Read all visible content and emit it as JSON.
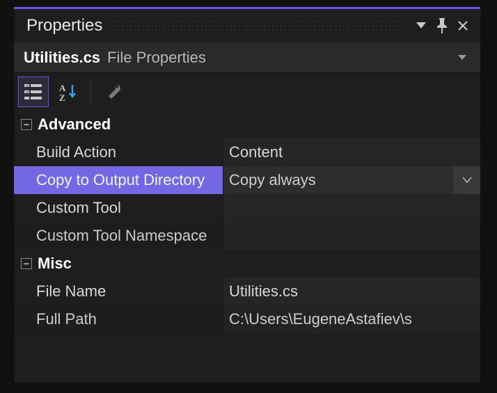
{
  "panel": {
    "title": "Properties"
  },
  "object": {
    "filename": "Utilities.cs",
    "type": "File Properties"
  },
  "toolbar": {
    "categorized": "Categorized",
    "alphabetical": "Alphabetical",
    "propertypages": "Property Pages"
  },
  "groups": [
    {
      "name": "Advanced",
      "expanded": true,
      "props": [
        {
          "name": "Build Action",
          "value": "Content",
          "selected": false
        },
        {
          "name": "Copy to Output Directory",
          "value": "Copy always",
          "selected": true
        },
        {
          "name": "Custom Tool",
          "value": "",
          "selected": false
        },
        {
          "name": "Custom Tool Namespace",
          "value": "",
          "selected": false
        }
      ]
    },
    {
      "name": "Misc",
      "expanded": true,
      "props": [
        {
          "name": "File Name",
          "value": "Utilities.cs",
          "selected": false
        },
        {
          "name": "Full Path",
          "value": "C:\\Users\\EugeneAstafiev\\s",
          "selected": false
        }
      ]
    }
  ]
}
